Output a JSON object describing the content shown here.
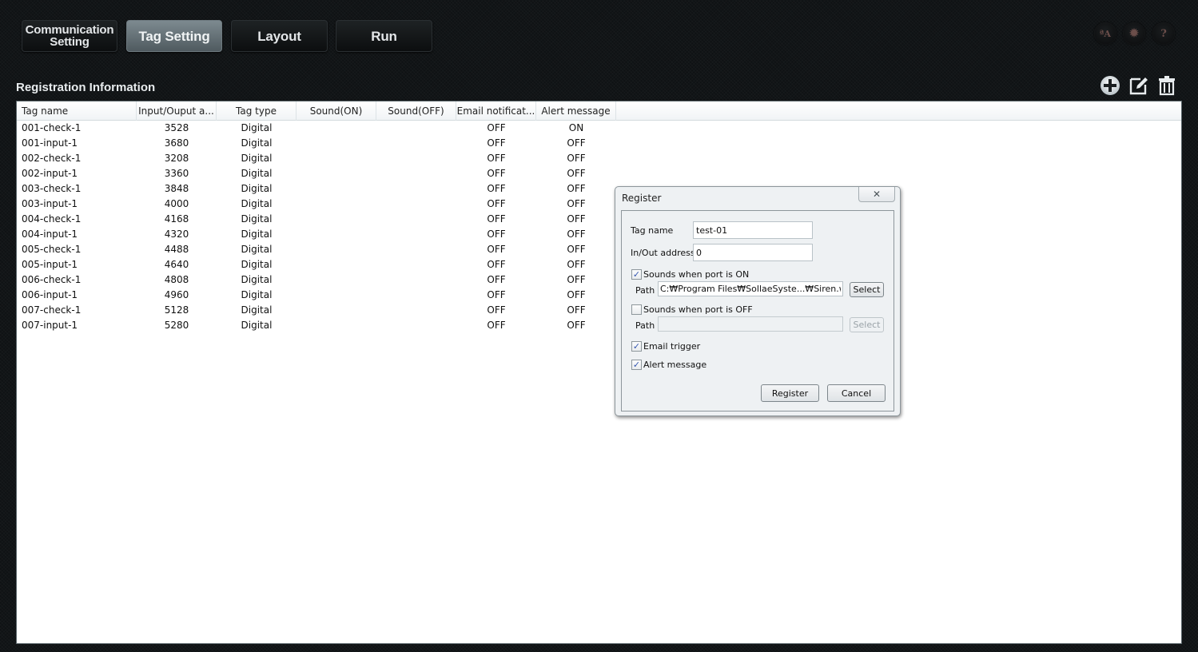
{
  "nav": {
    "tabs": [
      {
        "label_line1": "Communication",
        "label_line2": "Setting",
        "active": false
      },
      {
        "label": "Tag Setting",
        "active": true
      },
      {
        "label": "Layout",
        "active": false
      },
      {
        "label": "Run",
        "active": false
      }
    ],
    "top_icons": [
      "font-size-icon",
      "gear-icon",
      "help-icon"
    ],
    "top_icon_glyphs": [
      "ªA",
      "✹",
      "?"
    ]
  },
  "section": {
    "title": "Registration Information",
    "toolbar": [
      "add-icon",
      "edit-icon",
      "delete-icon"
    ]
  },
  "table": {
    "columns": [
      "Tag name",
      "Input/Ouput a...",
      "Tag type",
      "Sound(ON)",
      "Sound(OFF)",
      "Email notificat...",
      "Alert message"
    ],
    "rows": [
      [
        "001-check-1",
        "3528",
        "Digital",
        "",
        "",
        "OFF",
        "ON"
      ],
      [
        "001-input-1",
        "3680",
        "Digital",
        "",
        "",
        "OFF",
        "OFF"
      ],
      [
        "002-check-1",
        "3208",
        "Digital",
        "",
        "",
        "OFF",
        "OFF"
      ],
      [
        "002-input-1",
        "3360",
        "Digital",
        "",
        "",
        "OFF",
        "OFF"
      ],
      [
        "003-check-1",
        "3848",
        "Digital",
        "",
        "",
        "OFF",
        "OFF"
      ],
      [
        "003-input-1",
        "4000",
        "Digital",
        "",
        "",
        "OFF",
        "OFF"
      ],
      [
        "004-check-1",
        "4168",
        "Digital",
        "",
        "",
        "OFF",
        "OFF"
      ],
      [
        "004-input-1",
        "4320",
        "Digital",
        "",
        "",
        "OFF",
        "OFF"
      ],
      [
        "005-check-1",
        "4488",
        "Digital",
        "",
        "",
        "OFF",
        "OFF"
      ],
      [
        "005-input-1",
        "4640",
        "Digital",
        "",
        "",
        "OFF",
        "OFF"
      ],
      [
        "006-check-1",
        "4808",
        "Digital",
        "",
        "",
        "OFF",
        "OFF"
      ],
      [
        "006-input-1",
        "4960",
        "Digital",
        "",
        "",
        "OFF",
        "OFF"
      ],
      [
        "007-check-1",
        "5128",
        "Digital",
        "",
        "",
        "OFF",
        "OFF"
      ],
      [
        "007-input-1",
        "5280",
        "Digital",
        "",
        "",
        "OFF",
        "OFF"
      ]
    ]
  },
  "dialog": {
    "title": "Register",
    "close_glyph": "✕",
    "tag_name_label": "Tag name",
    "tag_name_value": "test-01",
    "address_label": "In/Out address",
    "address_value": "0",
    "sound_on_label": "Sounds when port is ON",
    "sound_on_checked": true,
    "path_label": "Path",
    "sound_on_path": "C:₩Program Files₩SollaeSyste...₩Siren.wav",
    "select_label": "Select",
    "sound_off_label": "Sounds when port is OFF",
    "sound_off_checked": false,
    "sound_off_path": "",
    "email_label": "Email trigger",
    "email_checked": true,
    "alert_label": "Alert message",
    "alert_checked": true,
    "register_label": "Register",
    "cancel_label": "Cancel",
    "check_glyph": "✓"
  }
}
